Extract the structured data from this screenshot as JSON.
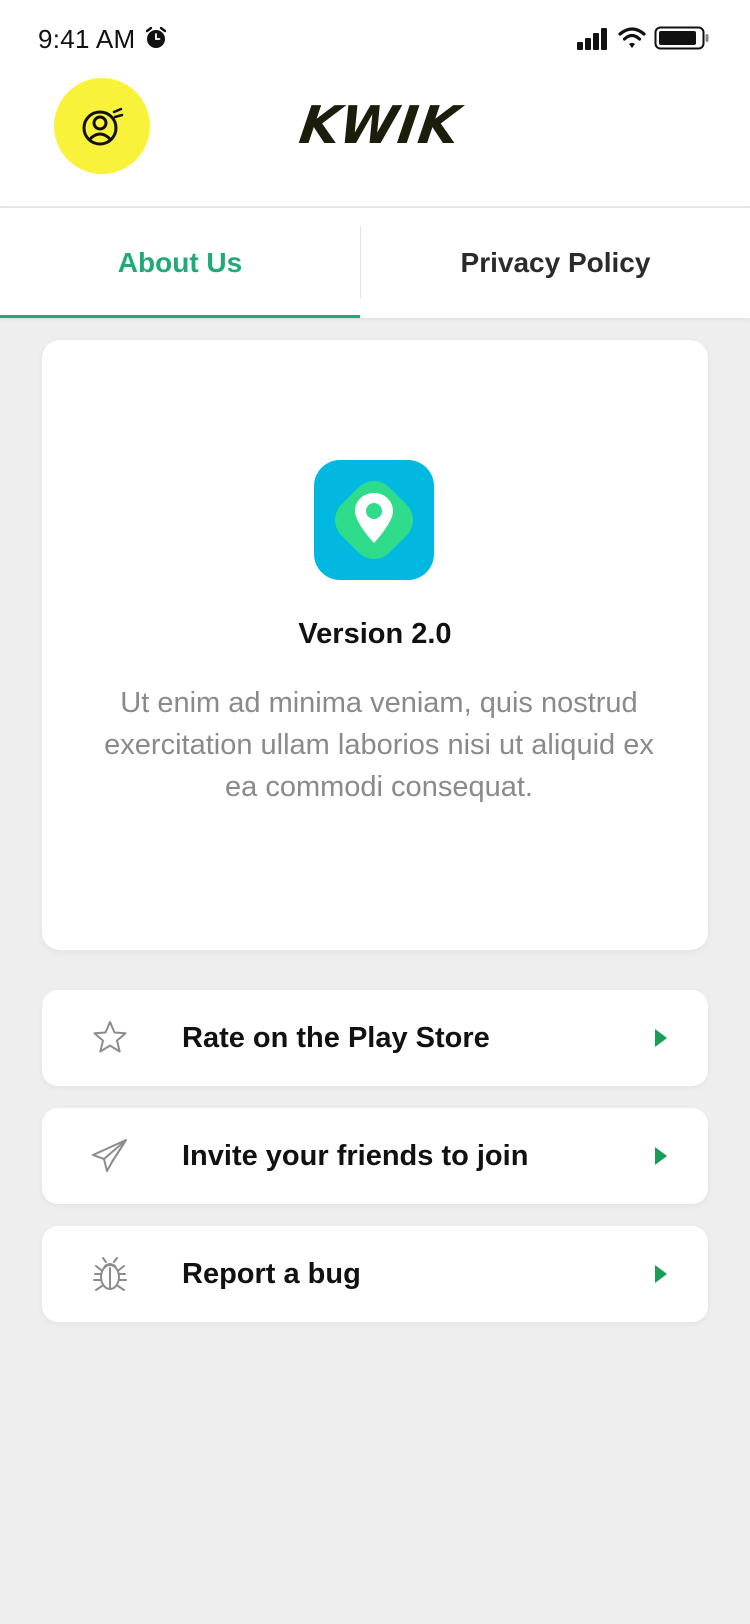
{
  "status_bar": {
    "time": "9:41 AM",
    "icons": [
      "alarm-icon",
      "cellular-signal-icon",
      "wifi-icon",
      "battery-icon"
    ]
  },
  "header": {
    "logo_text": "KWIK",
    "profile_icon": "user-profile-icon"
  },
  "tabs": [
    {
      "label": "About Us",
      "active": true
    },
    {
      "label": "Privacy Policy",
      "active": false
    }
  ],
  "about": {
    "app_icon": "location-pin-icon",
    "version": "Version 2.0",
    "description": "Ut enim ad minima veniam, quis nostrud exercitation ullam laborios nisi ut aliquid ex ea commodi consequat."
  },
  "actions": [
    {
      "label": "Rate on the Play Store",
      "icon": "star-icon"
    },
    {
      "label": "Invite your friends to join",
      "icon": "paper-plane-icon"
    },
    {
      "label": "Report a bug",
      "icon": "bug-icon"
    }
  ],
  "colors": {
    "accent": "#1faa78",
    "profile_bg": "#f8f33a",
    "app_icon_bg": "#00b8e0",
    "app_icon_inner": "#2edc8c",
    "arrow": "#1a9e55",
    "background": "#eeeeee"
  }
}
